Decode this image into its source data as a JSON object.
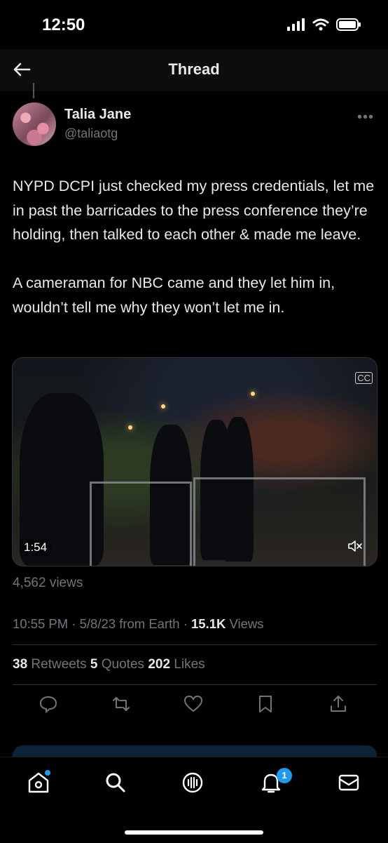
{
  "status_bar": {
    "time": "12:50"
  },
  "nav": {
    "title": "Thread"
  },
  "author": {
    "name": "Talia Jane",
    "handle": "@taliaotg"
  },
  "tweet": {
    "text": "NYPD DCPI just checked my press credentials, let me in past the barricades to the press conference they’re holding, then talked to each other & made me leave.\n\nA cameraman for NBC came and they let him in, wouldn’t tell me why they won’t let me in."
  },
  "media": {
    "duration": "1:54",
    "cc_label": "CC"
  },
  "views": "4,562 views",
  "meta": {
    "timestamp": "10:55 PM · 5/8/23 from Earth · ",
    "view_count": "15.1K",
    "view_label": " Views"
  },
  "stats": {
    "retweets_count": "38",
    "retweets_label": " Retweets ",
    "quotes_count": "5",
    "quotes_label": " Quotes ",
    "likes_count": "202",
    "likes_label": " Likes"
  },
  "actions": [
    "reply-icon",
    "retweet-icon",
    "like-icon",
    "bookmark-icon",
    "share-icon"
  ],
  "tabbar": {
    "items": [
      "home-icon",
      "search-icon",
      "spaces-icon",
      "notifications-icon",
      "messages-icon"
    ],
    "notification_badge": "1"
  },
  "colors": {
    "accent": "#1d9bf0",
    "background": "#000000",
    "secondary_text": "#71767b"
  }
}
